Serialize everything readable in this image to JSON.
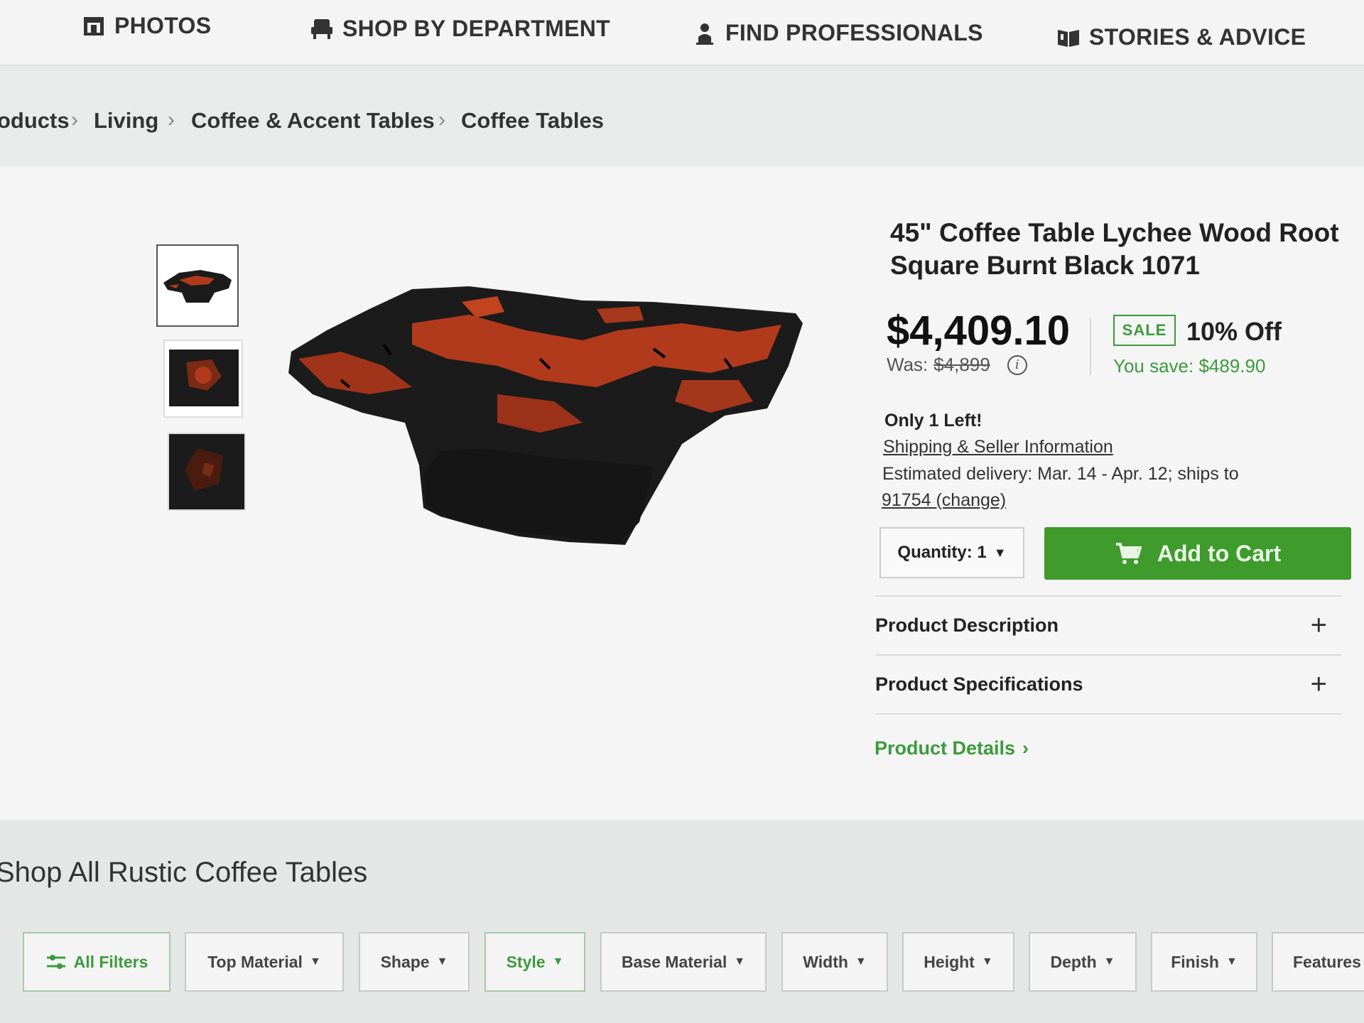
{
  "nav": {
    "items": [
      {
        "label": "PHOTOS",
        "icon": "photos-icon"
      },
      {
        "label": "SHOP BY DEPARTMENT",
        "icon": "armchair-icon"
      },
      {
        "label": "FIND PROFESSIONALS",
        "icon": "professional-icon"
      },
      {
        "label": "STORIES & ADVICE",
        "icon": "book-icon"
      }
    ]
  },
  "breadcrumb": {
    "items": [
      "oducts",
      "Living",
      "Coffee & Accent Tables",
      "Coffee Tables"
    ],
    "separator": "›"
  },
  "product": {
    "title": "45\" Coffee Table Lychee Wood Root Square Burnt Black 1071",
    "price": "$4,409.10",
    "was_label": "Was:",
    "was_price": "$4,899",
    "info_icon": "i",
    "sale_badge": "SALE",
    "discount": "10% Off",
    "you_save": "You save: $489.90",
    "stock": "Only 1 Left!",
    "shipping_link": "Shipping & Seller Information",
    "delivery": "Estimated delivery: Mar. 14 - Apr. 12; ships to",
    "zip_link": "91754 (change)",
    "quantity_label": "Quantity: 1",
    "add_to_cart": "Add to Cart",
    "accordion": [
      {
        "label": "Product Description",
        "icon": "+"
      },
      {
        "label": "Product Specifications",
        "icon": "+"
      }
    ],
    "details_link": "Product Details",
    "details_chevron": "›"
  },
  "section": {
    "title": "Shop All Rustic Coffee Tables"
  },
  "filters": [
    {
      "label": "All Filters",
      "icon": "filter-sliders-icon"
    },
    {
      "label": "Top Material"
    },
    {
      "label": "Shape"
    },
    {
      "label": "Style"
    },
    {
      "label": "Base Material"
    },
    {
      "label": "Width"
    },
    {
      "label": "Height"
    },
    {
      "label": "Depth"
    },
    {
      "label": "Finish"
    },
    {
      "label": "Features"
    }
  ],
  "colors": {
    "accent_green": "#3e9b2c",
    "wood_red": "#b23a1c",
    "char_black": "#1b1b1b"
  }
}
